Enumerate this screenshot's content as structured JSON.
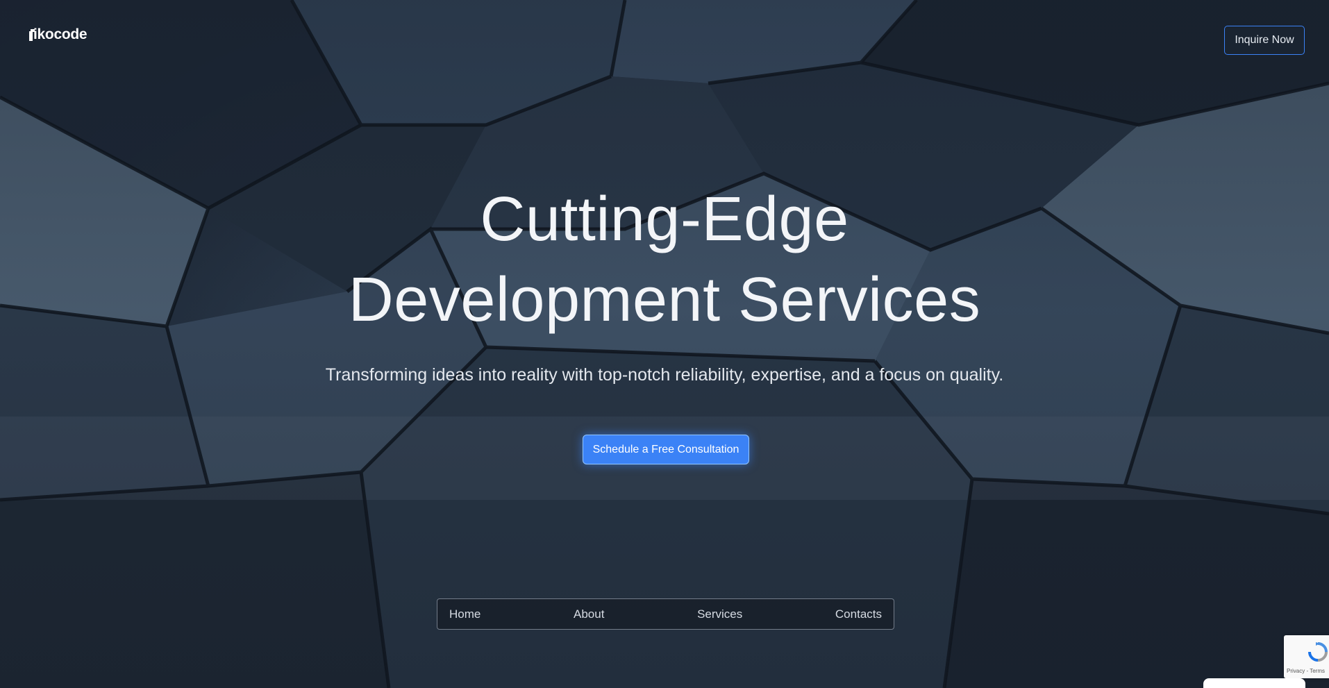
{
  "header": {
    "logo_text": "ikocode",
    "inquire_label": "Inquire Now"
  },
  "hero": {
    "headline_line1": "Cutting-Edge",
    "headline_line2": "Development Services",
    "subtitle": "Transforming ideas into reality with top-notch reliability, expertise, and a focus on quality.",
    "cta_label": "Schedule a Free Consultation"
  },
  "nav": {
    "items": [
      {
        "label": "Home"
      },
      {
        "label": "About"
      },
      {
        "label": "Services"
      },
      {
        "label": "Contacts"
      }
    ]
  },
  "recaptcha": {
    "privacy": "Privacy",
    "separator": " - ",
    "terms": "Terms"
  },
  "colors": {
    "accent": "#3b82f6",
    "text_primary": "#f3f5f8"
  }
}
